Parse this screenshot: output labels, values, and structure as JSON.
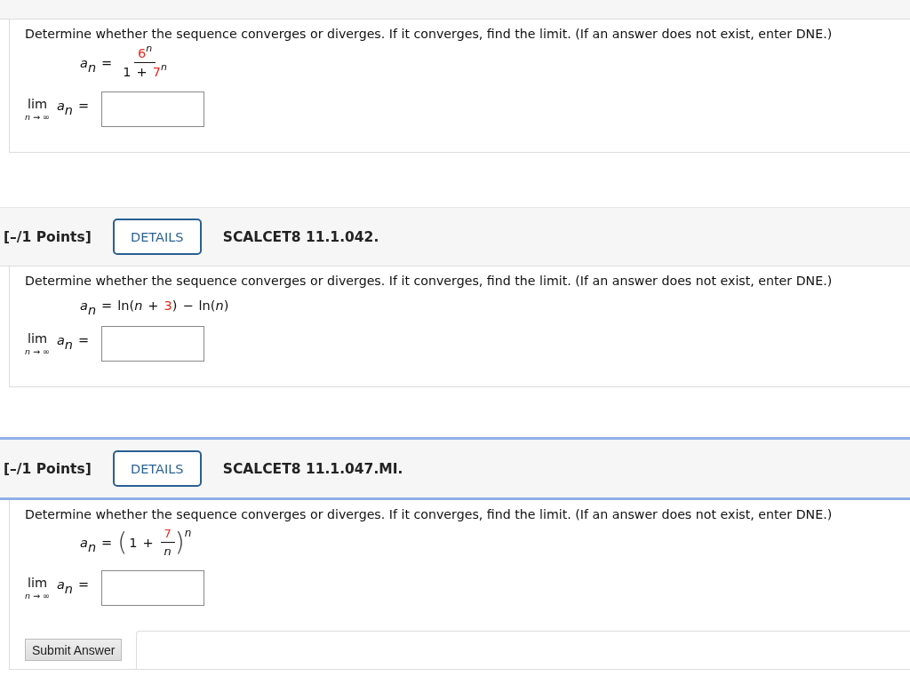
{
  "questions": [
    {
      "prompt": "Determine whether the sequence converges or diverges. If it converges, find the limit. (If an answer does not exist, enter DNE.)",
      "formula": {
        "kind": "fraction",
        "lhs": [
          {
            "text": "a",
            "kind": "var",
            "highlight": false
          },
          {
            "text": "n",
            "kind": "sub",
            "highlight": false
          },
          {
            "text": "=",
            "kind": "op",
            "highlight": false
          }
        ],
        "numerator": [
          {
            "text": "6",
            "kind": "num",
            "highlight": true
          },
          {
            "text": "n",
            "kind": "sup",
            "highlight": false
          }
        ],
        "denominator": [
          {
            "text": "1",
            "kind": "num",
            "highlight": false
          },
          {
            "text": "+",
            "kind": "op",
            "highlight": false
          },
          {
            "text": "7",
            "kind": "num",
            "highlight": true
          },
          {
            "text": "n",
            "kind": "sup",
            "highlight": false
          }
        ]
      },
      "limit": {
        "word": "lim",
        "under": "n → ∞",
        "expr": [
          {
            "text": "a",
            "kind": "var",
            "highlight": false
          },
          {
            "text": "n",
            "kind": "sub",
            "highlight": false
          },
          {
            "text": "=",
            "kind": "op",
            "highlight": false
          }
        ]
      }
    },
    {
      "header": {
        "points": "[–/1 Points]",
        "details": "DETAILS",
        "code": "SCALCET8 11.1.042."
      },
      "active": false,
      "prompt": "Determine whether the sequence converges or diverges. If it converges, find the limit. (If an answer does not exist, enter DNE.)",
      "formula": {
        "kind": "inline",
        "lhs": [
          {
            "text": "a",
            "kind": "var",
            "highlight": false
          },
          {
            "text": "n",
            "kind": "sub",
            "highlight": false
          },
          {
            "text": "=",
            "kind": "op",
            "highlight": false
          }
        ],
        "rhs": [
          {
            "text": "ln(",
            "kind": "num",
            "highlight": false
          },
          {
            "text": "n",
            "kind": "var",
            "highlight": false
          },
          {
            "text": "+",
            "kind": "op",
            "highlight": false
          },
          {
            "text": "3",
            "kind": "num",
            "highlight": true
          },
          {
            "text": ")",
            "kind": "num",
            "highlight": false
          },
          {
            "text": "−",
            "kind": "op",
            "highlight": false
          },
          {
            "text": "ln(",
            "kind": "num",
            "highlight": false
          },
          {
            "text": "n",
            "kind": "var",
            "highlight": false
          },
          {
            "text": ")",
            "kind": "num",
            "highlight": false
          }
        ]
      },
      "limit": {
        "word": "lim",
        "under": "n → ∞",
        "expr": [
          {
            "text": "a",
            "kind": "var",
            "highlight": false
          },
          {
            "text": "n",
            "kind": "sub",
            "highlight": false
          },
          {
            "text": "=",
            "kind": "op",
            "highlight": false
          }
        ]
      }
    },
    {
      "header": {
        "points": "[–/1 Points]",
        "details": "DETAILS",
        "code": "SCALCET8 11.1.047.MI."
      },
      "active": true,
      "prompt": "Determine whether the sequence converges or diverges. If it converges, find the limit. (If an answer does not exist, enter DNE.)",
      "formula": {
        "kind": "power",
        "lhs": [
          {
            "text": "a",
            "kind": "var",
            "highlight": false
          },
          {
            "text": "n",
            "kind": "sub",
            "highlight": false
          },
          {
            "text": "=",
            "kind": "op",
            "highlight": false
          }
        ],
        "open": "(",
        "base": [
          {
            "text": "1",
            "kind": "num",
            "highlight": false
          },
          {
            "text": "+",
            "kind": "op",
            "highlight": false
          }
        ],
        "numerator": [
          {
            "text": "7",
            "kind": "num",
            "highlight": true
          }
        ],
        "denominator": [
          {
            "text": "n",
            "kind": "var",
            "highlight": false
          }
        ],
        "close": ")",
        "exponent": "n"
      },
      "limit": {
        "word": "lim",
        "under": "n → ∞",
        "expr": [
          {
            "text": "a",
            "kind": "var",
            "highlight": false
          },
          {
            "text": "n",
            "kind": "sub",
            "highlight": false
          },
          {
            "text": "=",
            "kind": "op",
            "highlight": false
          }
        ]
      },
      "submit": "Submit Answer"
    }
  ]
}
